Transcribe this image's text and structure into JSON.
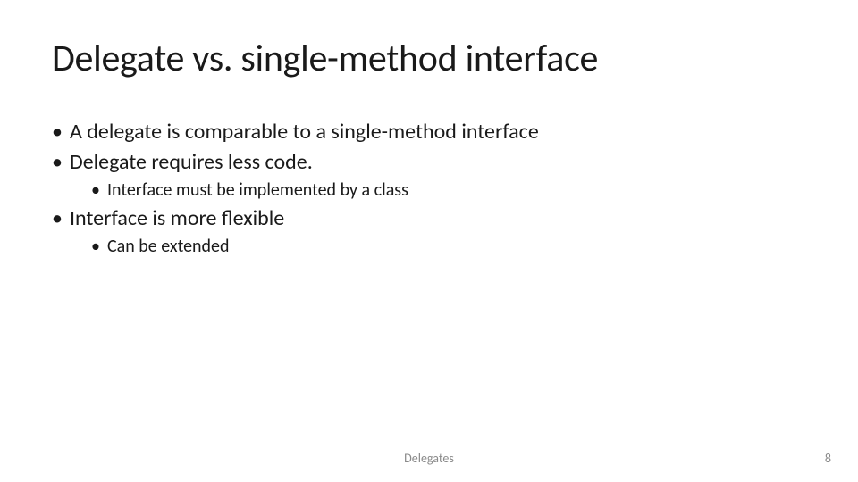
{
  "title": "Delegate vs. single-method interface",
  "bullets": {
    "b1": "A delegate is comparable to a single-method interface",
    "b2": "Delegate requires less code.",
    "b2_1": "Interface must be implemented by a class",
    "b3": "Interface is more flexible",
    "b3_1": "Can be extended"
  },
  "footer_text": "Delegates",
  "page_number": "8"
}
